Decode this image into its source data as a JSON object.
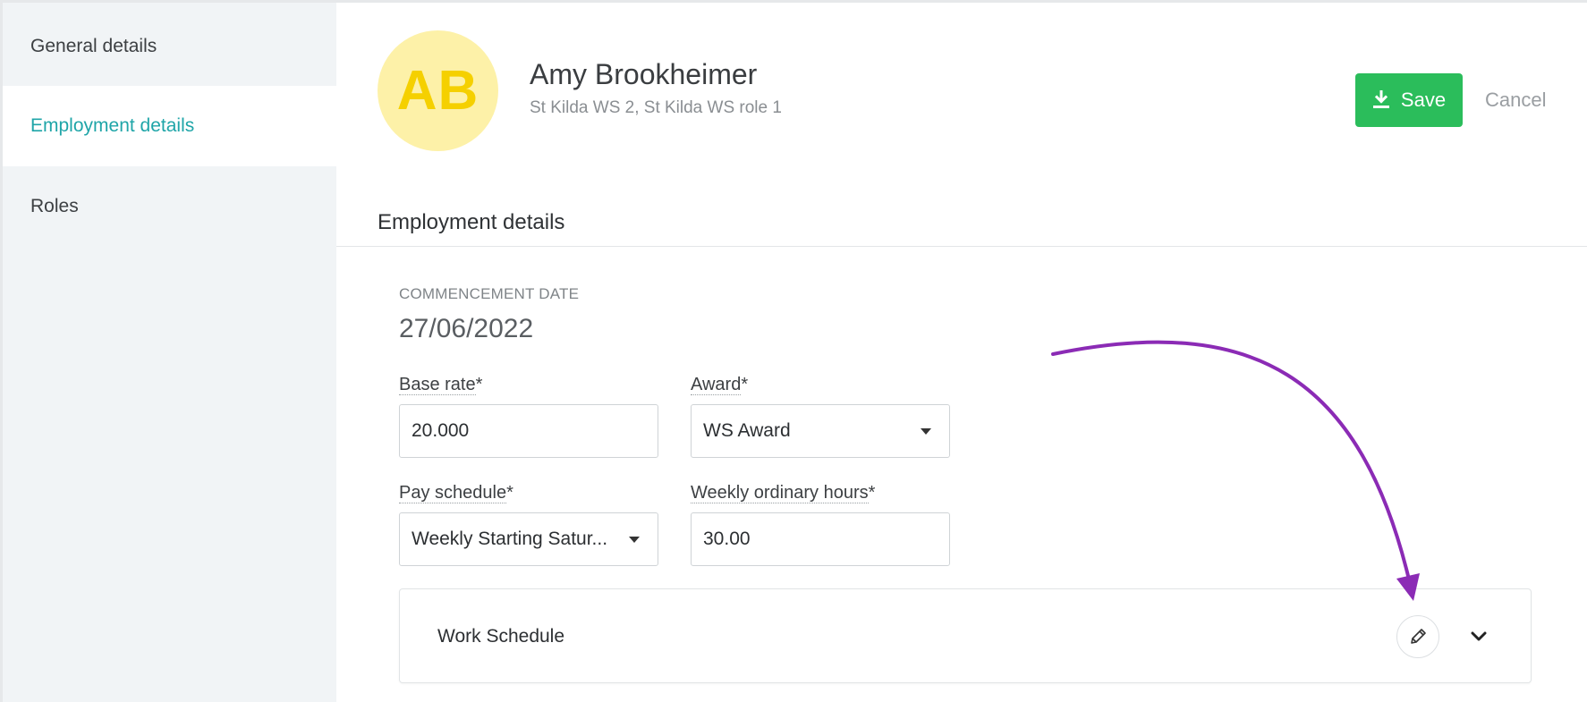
{
  "sidebar": {
    "items": [
      {
        "label": "General details"
      },
      {
        "label": "Employment details"
      },
      {
        "label": "Roles"
      }
    ]
  },
  "header": {
    "initials": "AB",
    "name": "Amy Brookheimer",
    "subtitle": "St Kilda WS 2, St Kilda WS role 1",
    "save_label": "Save",
    "cancel_label": "Cancel"
  },
  "section": {
    "title": "Employment details"
  },
  "commencement": {
    "label": "COMMENCEMENT DATE",
    "value": "27/06/2022"
  },
  "fields": {
    "base_rate": {
      "label": "Base rate",
      "required": "*",
      "value": "20.000"
    },
    "award": {
      "label": "Award",
      "required": "*",
      "value": "WS Award"
    },
    "pay_schedule": {
      "label": "Pay schedule",
      "required": "*",
      "value": "Weekly Starting Satur..."
    },
    "weekly_hours": {
      "label": "Weekly ordinary hours",
      "required": "*",
      "value": "30.00"
    }
  },
  "work_schedule": {
    "title": "Work Schedule"
  },
  "colors": {
    "accent": "#1fa5a8",
    "save": "#2bbd5b",
    "avatar_bg": "#fdf1a8",
    "avatar_text": "#f5d000",
    "annotation_arrow": "#8b2bb5"
  },
  "icons": {
    "save": "download-icon",
    "edit": "pencil-icon",
    "expand": "chevron-down-icon",
    "dropdown": "caret-down-icon"
  }
}
